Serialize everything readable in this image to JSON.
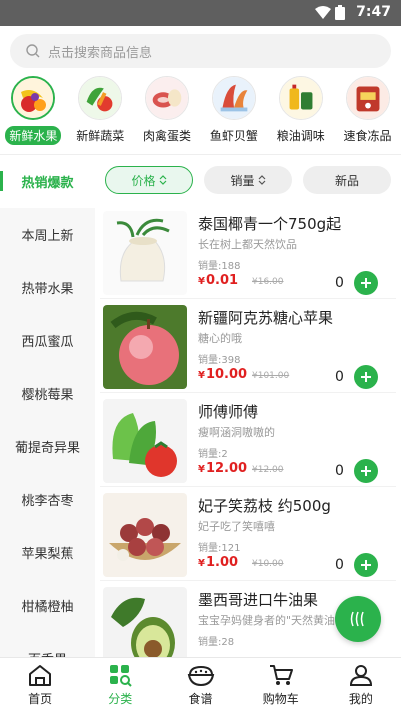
{
  "status_bar": {
    "time": "7:47"
  },
  "search": {
    "placeholder": "点击搜索商品信息"
  },
  "categories": [
    {
      "label": "新鲜水果",
      "icon": "fruit-icon",
      "active": true
    },
    {
      "label": "新鲜蔬菜",
      "icon": "vegetable-icon"
    },
    {
      "label": "肉禽蛋类",
      "icon": "meat-icon"
    },
    {
      "label": "鱼虾贝蟹",
      "icon": "seafood-icon"
    },
    {
      "label": "粮油调味",
      "icon": "grain-oil-icon"
    },
    {
      "label": "速食冻品",
      "icon": "frozen-food-icon"
    }
  ],
  "sidebar": {
    "items": [
      {
        "label": "热销爆款",
        "active": true
      },
      {
        "label": "本周上新"
      },
      {
        "label": "热带水果"
      },
      {
        "label": "西瓜蜜瓜"
      },
      {
        "label": "樱桃莓果"
      },
      {
        "label": "葡提奇异果"
      },
      {
        "label": "桃李杏枣"
      },
      {
        "label": "苹果梨蕉"
      },
      {
        "label": "柑橘橙柚"
      },
      {
        "label": "百香果"
      }
    ]
  },
  "filters": [
    {
      "label": "价格",
      "active": true,
      "icon": "sort-icon"
    },
    {
      "label": "销量",
      "icon": "sort-icon"
    },
    {
      "label": "新品"
    }
  ],
  "products": [
    {
      "name": "泰国椰青一个750g起",
      "desc": "长在树上都天然饮品",
      "sales": "销量:188",
      "price": "0.01",
      "old_price": "¥16.00",
      "qty": "0"
    },
    {
      "name": "新疆阿克苏糖心苹果",
      "desc": "糖心的哦",
      "sales": "销量:398",
      "price": "10.00",
      "old_price": "¥101.00",
      "qty": "0"
    },
    {
      "name": "师傅师傅",
      "desc": "瘦啊涵洞嗷嗷的",
      "sales": "销量:2",
      "price": "12.00",
      "old_price": "¥12.00",
      "qty": "0"
    },
    {
      "name": "妃子笑荔枝 约500g",
      "desc": "妃子吃了笑嘻嘻",
      "sales": "销量:121",
      "price": "1.00",
      "old_price": "¥10.00",
      "qty": "0"
    },
    {
      "name": "墨西哥进口牛油果",
      "desc": "宝宝孕妈健身者的\"天然黄油\"",
      "sales": "销量:28",
      "price": "",
      "old_price": "",
      "qty": ""
    }
  ],
  "currency": "¥",
  "tabbar": [
    {
      "label": "首页",
      "icon": "home-icon"
    },
    {
      "label": "分类",
      "icon": "category-icon",
      "active": true
    },
    {
      "label": "食谱",
      "icon": "recipe-icon"
    },
    {
      "label": "购物车",
      "icon": "cart-icon"
    },
    {
      "label": "我的",
      "icon": "profile-icon"
    }
  ],
  "colors": {
    "accent": "#2bb24c",
    "price": "#e02020"
  }
}
